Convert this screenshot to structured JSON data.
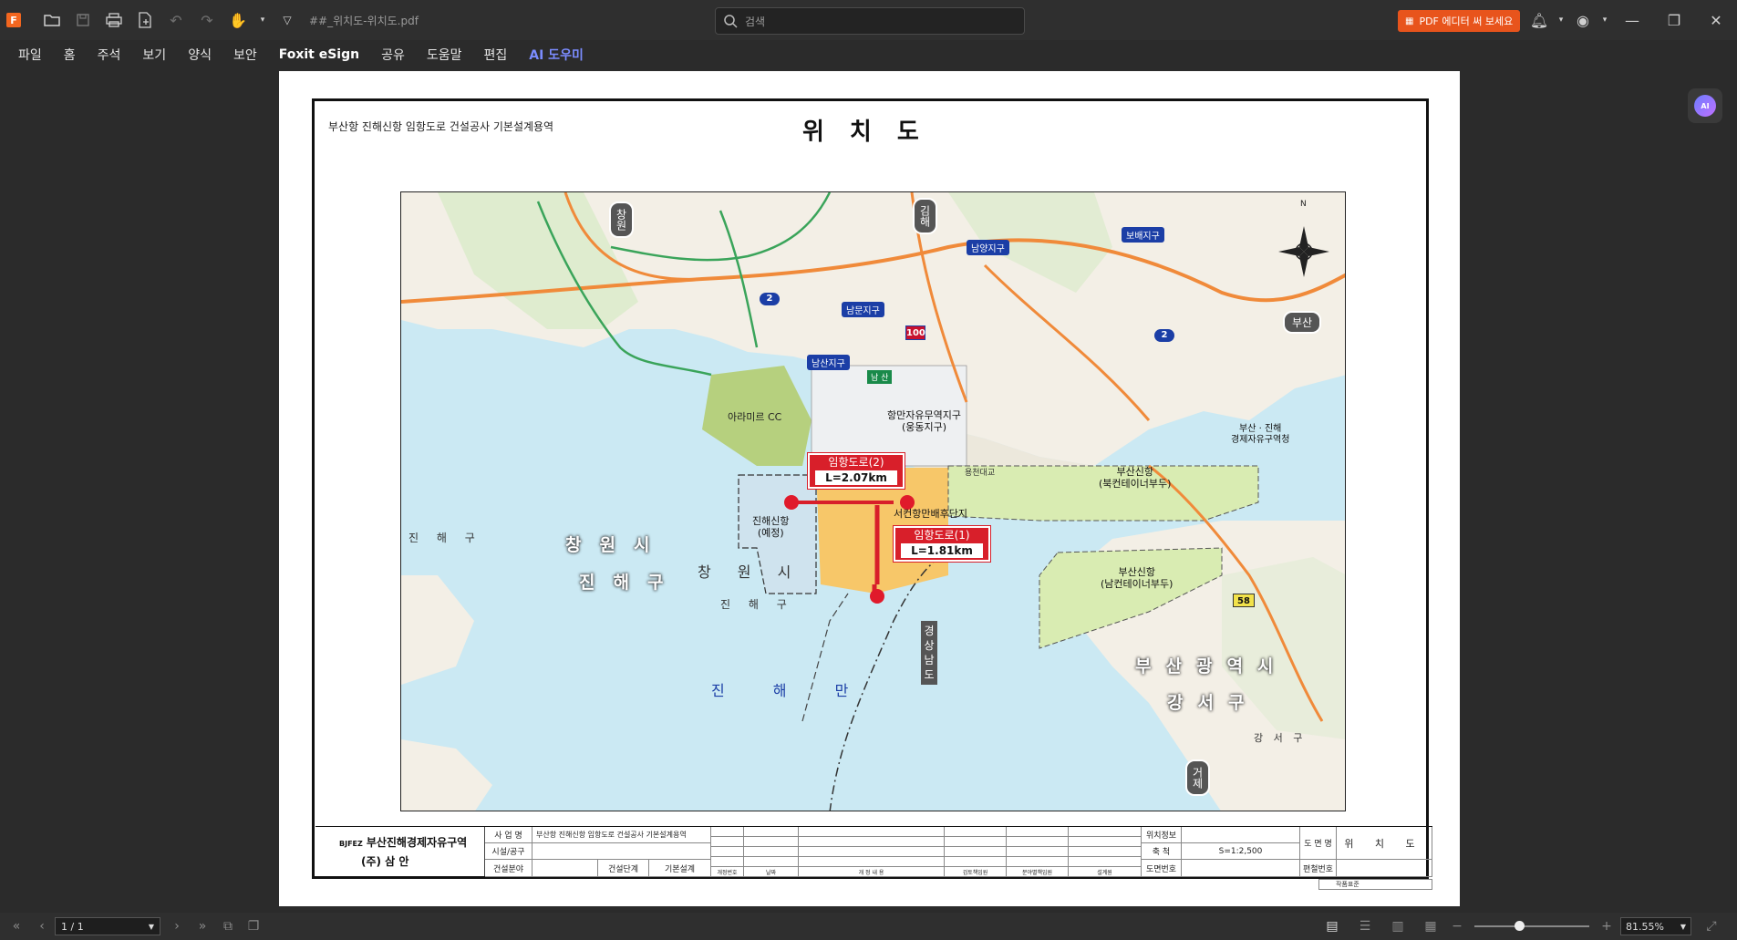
{
  "app": {
    "doc_title": "##_위치도-위치도.pdf",
    "search_placeholder": "검색",
    "pdf_editor_button": "PDF 에디터 써 보세요"
  },
  "menu": [
    "파일",
    "홈",
    "주석",
    "보기",
    "양식",
    "보안",
    "Foxit eSign",
    "공유",
    "도움말",
    "편집",
    "AI 도우미"
  ],
  "page": {
    "project_title": "부산항 진해신항 임항도로 건설공사 기본설계용역",
    "drawing_title": "위치도",
    "map_labels": {
      "road2_name": "임항도로(2)",
      "road2_length": "L=2.07km",
      "road1_name": "임항도로(1)",
      "road1_length": "L=1.81km",
      "changwon": "창원시",
      "jinhae_gu": "진해구",
      "changwon_small": "창 원 시",
      "jinhae_gu_small": "진 해 구",
      "jinhae_gu_left": "진 해 구",
      "jinhae_bay": "진 해 만",
      "busan": "부산광역시",
      "gangseo": "강서구",
      "gangseo_small": "강 서 구",
      "gyeongnam": "경상남도",
      "jinhae_newport": "진해신항",
      "jinhae_newport_planned": "(예정)",
      "hinterland": "서컨항만배후단지",
      "arami_cc": "아라미르 CC",
      "port_free_zone": "항만자유무역지구",
      "port_free_zone_sub": "(웅동지구)",
      "busan_newport_north": "부산신항",
      "north_container": "(북컨테이너부두)",
      "busan_newport_south": "부산신항",
      "south_container": "(남컨테이너부두)",
      "busan_jinhae_fez": "부산 · 진해",
      "fez_office": "경제자유구역청",
      "namsan": "남산지구",
      "nammun": "남문지구",
      "namyang": "남양지구",
      "bobae": "보배지구",
      "busan_arrow": "부산",
      "changwon_arrow": "창원",
      "gimhae_arrow": "김해",
      "geoje_arrow": "거제",
      "road_2": "2",
      "road_2b": "2",
      "road_100": "100",
      "road_58": "58",
      "north": "N",
      "ahnsan": "남 산",
      "youngcheon": "용천대교"
    },
    "title_block": {
      "logo_line1": "부산진해경제자유구역",
      "logo_prefix": "BJFEZ",
      "company": "(주) 삼 안",
      "row_labels": [
        "사 업 명",
        "시설/공구",
        "건설분야"
      ],
      "project_name": "부산항 진해신항 임항도로 건설공사 기본설계용역",
      "phase_label": "건설단계",
      "phase_value": "기본설계",
      "revision_headers": [
        "개정번호",
        "날짜",
        "개 정 내 용",
        "검토책임원",
        "분야별책임원",
        "설계원"
      ],
      "info_labels": [
        "위치정보",
        "축 척",
        "도면번호"
      ],
      "scale": "S=1:2,500",
      "name_label": "도 면 명",
      "name_value": "위 치 도",
      "file_label": "편철번호",
      "note": "작품표준"
    }
  },
  "status": {
    "page_value": "1 / 1",
    "zoom_value": "81.55%"
  },
  "colors": {
    "accent_orange": "#e8541c",
    "road_red": "#d81f2a",
    "sea": "#cbe9f3"
  }
}
